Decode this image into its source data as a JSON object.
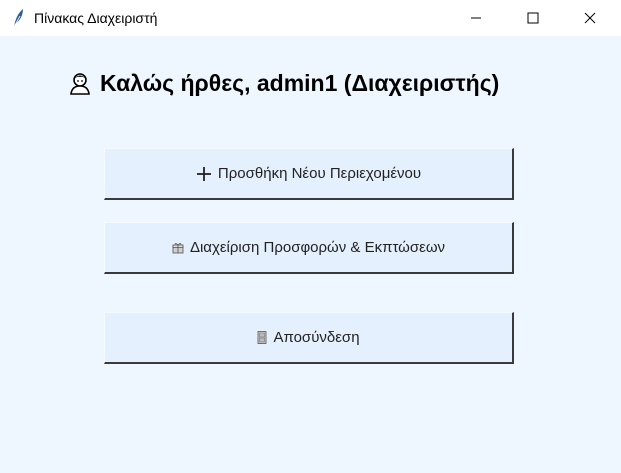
{
  "window": {
    "title": "Πίνακας Διαχειριστή",
    "icon": "feather-icon",
    "controls": [
      "minimize-icon",
      "maximize-icon",
      "close-icon"
    ]
  },
  "header": {
    "icon": "admin-user-icon",
    "title": "Καλώς ήρθες, admin1 (Διαχειριστής)"
  },
  "buttons": {
    "add_content": {
      "icon": "plus-icon",
      "label": "Προσθήκη Νέου Περιεχομένου"
    },
    "manage_offers": {
      "icon": "gift-icon",
      "label": "Διαχείριση Προσφορών & Εκπτώσεων"
    },
    "logout": {
      "icon": "door-icon",
      "label": "Αποσύνδεση"
    }
  },
  "colors": {
    "background": "#eef6ff",
    "button_face": "#e4f0fd",
    "titlebar": "#ffffff"
  }
}
